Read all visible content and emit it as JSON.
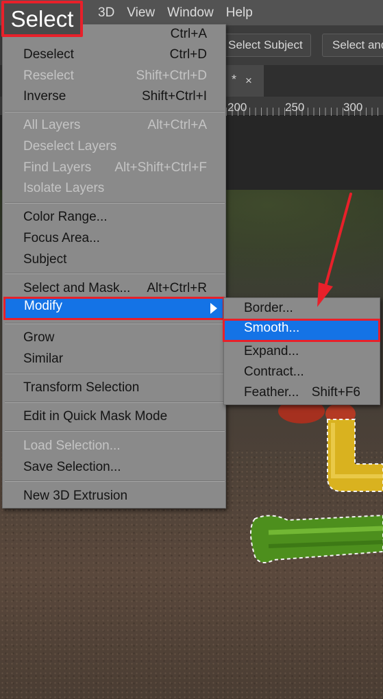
{
  "menubar": {
    "active_menu": "Select",
    "items": [
      "3D",
      "View",
      "Window",
      "Help"
    ]
  },
  "options_bar": {
    "select_subject": "Select Subject",
    "select_and_mask": "Select and Mask..."
  },
  "document_tab": {
    "modified_marker": "*",
    "close_glyph": "×"
  },
  "ruler": {
    "labels": [
      "200",
      "250",
      "300"
    ]
  },
  "select_menu": {
    "items": [
      {
        "label": "Deselect",
        "shortcut": "Ctrl+D",
        "enabled": true
      },
      {
        "label": "Reselect",
        "shortcut": "Shift+Ctrl+D",
        "enabled": false
      },
      {
        "label": "Inverse",
        "shortcut": "Shift+Ctrl+I",
        "enabled": true
      },
      {
        "label": "All Layers",
        "shortcut": "Alt+Ctrl+A",
        "enabled": false
      },
      {
        "label": "Deselect Layers",
        "shortcut": "",
        "enabled": false
      },
      {
        "label": "Find Layers",
        "shortcut": "Alt+Shift+Ctrl+F",
        "enabled": false
      },
      {
        "label": "Isolate Layers",
        "shortcut": "",
        "enabled": false
      },
      {
        "label": "Color Range...",
        "shortcut": "",
        "enabled": true
      },
      {
        "label": "Focus Area...",
        "shortcut": "",
        "enabled": true
      },
      {
        "label": "Subject",
        "shortcut": "",
        "enabled": true
      },
      {
        "label": "Select and Mask...",
        "shortcut": "Alt+Ctrl+R",
        "enabled": true
      },
      {
        "label": "Modify",
        "shortcut": "",
        "enabled": true,
        "has_submenu": true,
        "highlighted": true
      },
      {
        "label": "Grow",
        "shortcut": "",
        "enabled": true
      },
      {
        "label": "Similar",
        "shortcut": "",
        "enabled": true
      },
      {
        "label": "Transform Selection",
        "shortcut": "",
        "enabled": true
      },
      {
        "label": "Edit in Quick Mask Mode",
        "shortcut": "",
        "enabled": true
      },
      {
        "label": "Load Selection...",
        "shortcut": "",
        "enabled": false
      },
      {
        "label": "Save Selection...",
        "shortcut": "",
        "enabled": true
      },
      {
        "label": "New 3D Extrusion",
        "shortcut": "",
        "enabled": true
      }
    ],
    "first_shortcut": "Ctrl+A"
  },
  "modify_submenu": {
    "items": [
      {
        "label": "Border...",
        "shortcut": ""
      },
      {
        "label": "Smooth...",
        "shortcut": "",
        "highlighted": true
      },
      {
        "label": "Expand...",
        "shortcut": ""
      },
      {
        "label": "Contract...",
        "shortcut": ""
      },
      {
        "label": "Feather...",
        "shortcut": "Shift+F6"
      }
    ]
  },
  "colors": {
    "menu_bg": "#8a8a8a",
    "highlight": "#1473e6",
    "annotation_red": "#e8202a",
    "disabled_text": "#c4c4c4"
  },
  "icons": [
    "submenu-arrow-icon",
    "close-icon",
    "annotation-arrow-icon"
  ]
}
